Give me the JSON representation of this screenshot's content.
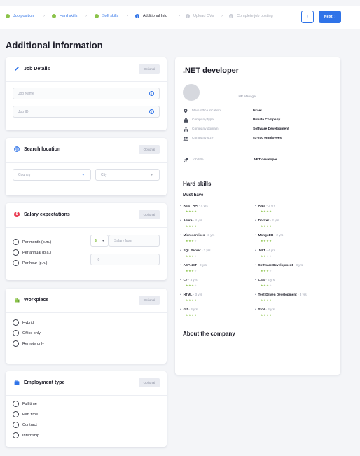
{
  "stepper": {
    "steps": [
      {
        "label": "Job position",
        "state": "done"
      },
      {
        "label": "Hard skills",
        "state": "done"
      },
      {
        "label": "Soft skills",
        "state": "done"
      },
      {
        "label": "Additional Info",
        "state": "current",
        "number": "4"
      },
      {
        "label": "Upload CVs",
        "state": "todo",
        "number": "5"
      },
      {
        "label": "Complete job posting",
        "state": "todo",
        "number": "6"
      }
    ],
    "prev_label": "‹",
    "next_label": "Next",
    "next_arrow": "›"
  },
  "page_title": "Additional information",
  "job_details": {
    "title": "Job Details",
    "optional": "Optional",
    "job_name_placeholder": "Job Name",
    "job_id_placeholder": "Job ID"
  },
  "search_location": {
    "title": "Search location",
    "optional": "Optional",
    "country_placeholder": "Country",
    "city_placeholder": "City"
  },
  "salary": {
    "title": "Salary expectations",
    "optional": "Optional",
    "options": [
      "Per month (p.m.)",
      "Per annual (p.a.)",
      "Per hour (p.h.)"
    ],
    "currency": "$",
    "from_placeholder": "Salary from",
    "to_placeholder": "To"
  },
  "workplace": {
    "title": "Workplace",
    "optional": "Optional",
    "options": [
      "Hybrid",
      "Office only",
      "Remote only"
    ]
  },
  "employment": {
    "title": "Employment type",
    "optional": "Optional",
    "options": [
      "Full time",
      "Part time",
      "Contract",
      "Internship"
    ]
  },
  "preview": {
    "job_title": ".NET developer",
    "hr_manager": ", HR Manager",
    "info": [
      {
        "icon": "location-pin-icon",
        "key": "Main office location",
        "value": "Israel"
      },
      {
        "icon": "briefcase-icon",
        "key": "Company type",
        "value": "Private Company"
      },
      {
        "icon": "sitemap-icon",
        "key": "Company domain",
        "value": "Software Development"
      },
      {
        "icon": "people-icon",
        "key": "Company size",
        "value": "51-200 employees"
      }
    ],
    "job_title_row": {
      "icon": "rocket-icon",
      "key": "Job title",
      "value": ".NET developer"
    },
    "hard_skills_heading": "Hard skills",
    "must_have_heading": "Must have",
    "skills_left": [
      {
        "name": "REST API",
        "years": " - 4 yrs",
        "rating": 4
      },
      {
        "name": "Azure",
        "years": " - 4 yrs",
        "rating": 4
      },
      {
        "name": "Microservices",
        "years": " - 3 yrs",
        "rating": 3
      },
      {
        "name": "SQL Server",
        "years": " - 3 yrs",
        "rating": 3
      },
      {
        "name": "ASP.NET",
        "years": " - 2 yrs",
        "rating": 3
      },
      {
        "name": "C#",
        "years": " - 3 yrs",
        "rating": 3
      },
      {
        "name": "HTML",
        "years": " - 3 yrs",
        "rating": 4
      },
      {
        "name": "Git",
        "years": " - 3 yrs",
        "rating": 4
      }
    ],
    "skills_right": [
      {
        "name": "AWS",
        "years": " - 3 yrs",
        "rating": 4
      },
      {
        "name": "Docker",
        "years": " - 2 yrs",
        "rating": 4
      },
      {
        "name": "MongoDB",
        "years": " - 2 yrs",
        "rating": 4
      },
      {
        "name": ".NET",
        "years": " - 4 yrs",
        "rating": 2
      },
      {
        "name": "Software Development",
        "years": " - 3 yrs",
        "rating": 3
      },
      {
        "name": "CSS",
        "years": " - 4 yrs",
        "rating": 3
      },
      {
        "name": "Test-Driven Development",
        "years": " - 3 yrs",
        "rating": 4
      },
      {
        "name": "SVN",
        "years": " - 3 yrs",
        "rating": 4
      }
    ],
    "about_heading": "About the company"
  },
  "colors": {
    "accent": "#2f73e8",
    "done": "#8bc34a",
    "star_on": "#8bc34a",
    "star_off": "#d6d8de"
  }
}
